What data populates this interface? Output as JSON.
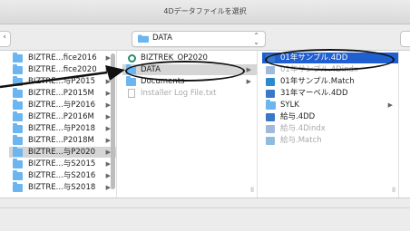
{
  "window": {
    "title": "4Dデータファイルを選択"
  },
  "toolbar": {
    "path_label": "DATA",
    "back_glyph": "‹",
    "updown_glyph": "⌃⌄"
  },
  "columns": {
    "col1": [
      {
        "label": "BIZTRE...fice2016",
        "chevron": "▶"
      },
      {
        "label": "BIZTRE...fice2020",
        "chevron": "▶"
      },
      {
        "label": "BIZTRE...与P2015",
        "chevron": "▶"
      },
      {
        "label": "BIZTRE...P2015M",
        "chevron": "▶"
      },
      {
        "label": "BIZTRE...与P2016",
        "chevron": "▶"
      },
      {
        "label": "BIZTRE...P2016M",
        "chevron": "▶"
      },
      {
        "label": "BIZTRE...与P2018",
        "chevron": "▶"
      },
      {
        "label": "BIZTRE...P2018M",
        "chevron": "▶"
      },
      {
        "label": "BIZTRE...与P2020",
        "chevron": "▶",
        "selected": true
      },
      {
        "label": "BIZTRE...与S2015",
        "chevron": "▶"
      },
      {
        "label": "BIZTRE...与S2016",
        "chevron": "▶"
      },
      {
        "label": "BIZTRE...与S2018",
        "chevron": "▶"
      }
    ],
    "col2": [
      {
        "label": "BIZTREK_OP2020",
        "icon": "gear-icon"
      },
      {
        "label": "DATA",
        "icon": "folder-icon",
        "chevron": "▶",
        "selected": true
      },
      {
        "label": "Documents",
        "icon": "folder-icon",
        "chevron": "▶"
      },
      {
        "label": "Installer Log File.txt",
        "icon": "document-icon",
        "dim": true
      }
    ],
    "col3": [
      {
        "label": "01年サンプル.4DD",
        "icon": "database-icon",
        "highlighted": true
      },
      {
        "label": "01年サンプル.4Dindx",
        "icon": "database-icon",
        "dim": true
      },
      {
        "label": "01年サンプル.Match",
        "icon": "match-icon"
      },
      {
        "label": "31年マーベル.4DD",
        "icon": "database-icon"
      },
      {
        "label": "SYLK",
        "icon": "folder-icon",
        "chevron": "▶"
      },
      {
        "label": "給与.4DD",
        "icon": "database-icon"
      },
      {
        "label": "給与.4Dindx",
        "icon": "database-icon",
        "dim": true
      },
      {
        "label": "給与.Match",
        "icon": "match-icon",
        "dim": true
      }
    ]
  },
  "colors": {
    "folder": "#6bb5f0",
    "selection_gray": "#d5d5d5",
    "annotation": "#111111"
  }
}
